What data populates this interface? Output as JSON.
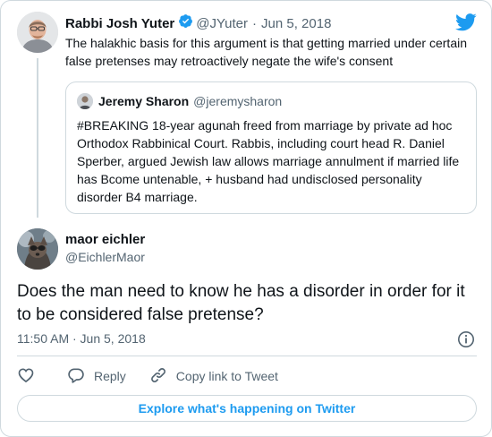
{
  "colors": {
    "accent": "#1d9bf0",
    "text": "#0f1419",
    "muted": "#536471",
    "border": "#cfd9de"
  },
  "parent_tweet": {
    "name": "Rabbi Josh Yuter",
    "handle": "@JYuter",
    "separator": "·",
    "date": "Jun 5, 2018",
    "verified": true,
    "text": "The halakhic basis for this argument is that getting married under certain false pretenses may retroactively negate the wife's consent"
  },
  "quoted_tweet": {
    "name": "Jeremy Sharon",
    "handle": "@jeremysharon",
    "text": "#BREAKING 18-year agunah freed from marriage by private ad hoc Orthodox Rabbinical Court. Rabbis, including court head R. Daniel Sperber, argued Jewish law allows marriage annulment if married life has Bcome untenable, + husband had undisclosed personality disorder B4 marriage."
  },
  "main_tweet": {
    "name": "maor eichler",
    "handle": "@EichlerMaor",
    "text": "Does the man need to know he has a disorder in order for it to be considered false pretense?",
    "timestamp": "11:50 AM · Jun 5, 2018"
  },
  "actions": {
    "like_icon": "heart-icon",
    "reply_label": "Reply",
    "copy_link_label": "Copy link to Tweet"
  },
  "explore_label": "Explore what's happening on Twitter",
  "icons": [
    "twitter-bird-icon",
    "verified-badge-icon",
    "info-icon",
    "heart-icon",
    "reply-icon",
    "link-icon"
  ]
}
